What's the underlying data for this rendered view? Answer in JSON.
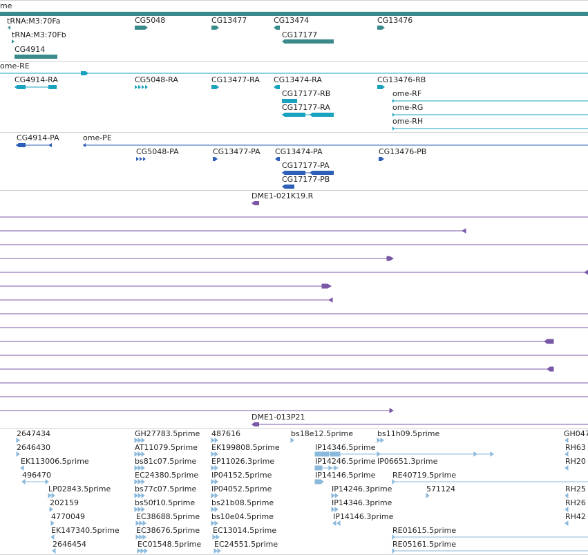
{
  "colors": {
    "gene": "#3a8a8c",
    "transcript": "#1aa3bf",
    "protein": "#2e5fb8",
    "clone": "#7a58a8",
    "est": "#8ab9dc",
    "separator": "#cfcfcf",
    "text": "#222222"
  },
  "tracks": {
    "genes": {
      "top_label": "me",
      "labels": [
        "tRNA:M3:70Fa",
        "tRNA:M3:70Fb",
        "CG4914",
        "CG5048",
        "CG13477",
        "CG13474",
        "CG17177",
        "CG13476"
      ]
    },
    "transcripts": {
      "labels": [
        "ome-RE",
        "CG4914-RA",
        "CG5048-RA",
        "CG13477-RA",
        "CG13474-RA",
        "CG17177-RB",
        "CG17177-RA",
        "CG13476-RB",
        "ome-RF",
        "ome-RG",
        "ome-RH"
      ]
    },
    "proteins": {
      "labels": [
        "CG4914-PA",
        "ome-PE",
        "CG5048-PA",
        "CG13477-PA",
        "CG13474-PA",
        "CG13476-PB",
        "CG17177-PA",
        "CG17177-PB"
      ]
    },
    "clones": {
      "labels": [
        "DME1-021K19.R",
        "DME1-013P21"
      ]
    },
    "ests": {
      "col1": [
        "2647434",
        "2646430",
        "EK113006.5prime",
        "496470",
        "LP02843.5prime",
        "202159",
        "4770049",
        "EK147340.5prime",
        "2646454"
      ],
      "col2": [
        "GH27783.5prime",
        "AT11079.5prime",
        "bs81c07.5prime",
        "EC24380.5prime",
        "bs77c07.5prime",
        "bs50f10.5prime",
        "EC38688.5prime",
        "EC38676.5prime",
        "EC01548.5prime"
      ],
      "col3": [
        "487616",
        "EK199808.5prime",
        "EP11026.3prime",
        "IP04152.5prime",
        "IP04052.5prime",
        "bs21b08.5prime",
        "bs10e04.5prime",
        "EC13014.5prime",
        "EC24551.5prime"
      ],
      "col4": [
        "bs18e12.5prime",
        "IP14346.5prime",
        "IP14246.5prime",
        "IP14146.5prime",
        "IP14246.3prime",
        "IP14346.3prime",
        "IP14146.3prime"
      ],
      "col5": [
        "bs11h09.5prime",
        "IP06651.3prime",
        "RE40719.5prime",
        "571124",
        "RE01615.5prime",
        "RE05161.5prime"
      ],
      "col6": [
        "GH047",
        "RH63",
        "RH20",
        "RH25",
        "RH26",
        "RH42"
      ]
    }
  }
}
